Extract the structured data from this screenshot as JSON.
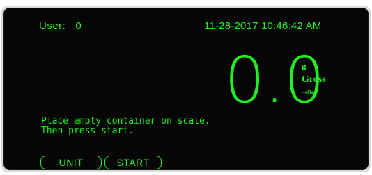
{
  "header": {
    "user_label": "User:",
    "user_value": "0",
    "datetime": "11-28-2017 10:46:42 AM"
  },
  "display": {
    "weight": "0.0",
    "unit": "g",
    "mode": "Gross",
    "zero_indicator": "→0←"
  },
  "message": {
    "line1": "Place empty container on scale.",
    "line2": "Then press start."
  },
  "buttons": {
    "unit_label": "UNIT",
    "start_label": "START"
  },
  "colors": {
    "text": "#22ee22",
    "background": "#060606",
    "bezel": "#d9d9d9"
  }
}
